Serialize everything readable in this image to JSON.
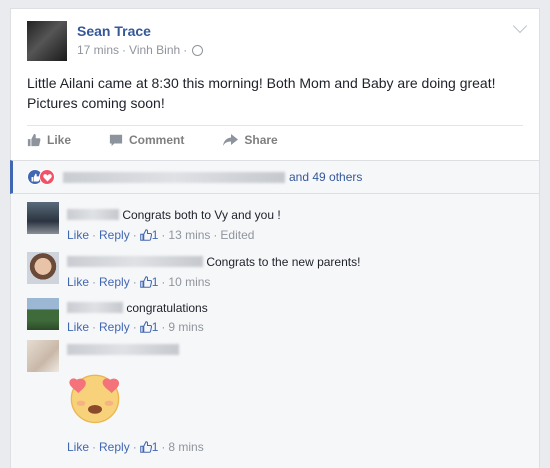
{
  "post": {
    "author": "Sean Trace",
    "time": "17 mins",
    "location": "Vinh Binh",
    "text": "Little Ailani came at 8:30 this morning! Both Mom and Baby are doing great! Pictures coming soon!",
    "actions": {
      "like": "Like",
      "comment": "Comment",
      "share": "Share"
    }
  },
  "reactions": {
    "others_text": "and 49 others"
  },
  "comments": [
    {
      "text": "Congrats both to Vy and you !",
      "like": "Like",
      "reply": "Reply",
      "count": "1",
      "time": "13 mins",
      "edited": "Edited"
    },
    {
      "text": "Congrats to the new parents!",
      "like": "Like",
      "reply": "Reply",
      "count": "1",
      "time": "10 mins"
    },
    {
      "text": "congratulations",
      "like": "Like",
      "reply": "Reply",
      "count": "1",
      "time": "9 mins"
    },
    {
      "text": "",
      "like": "Like",
      "reply": "Reply",
      "count": "1",
      "time": "8 mins"
    }
  ],
  "colors": {
    "link": "#365899",
    "action_link": "#4267b2",
    "love": "#f25268"
  }
}
